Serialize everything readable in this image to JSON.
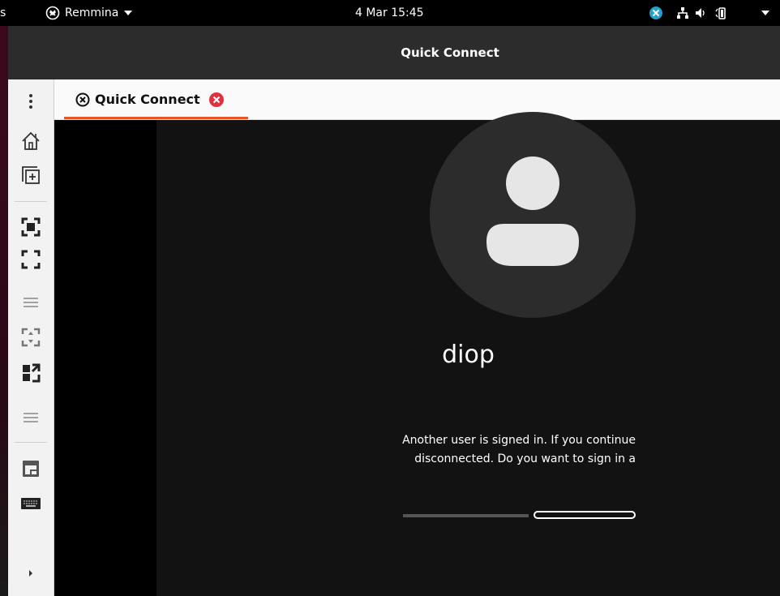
{
  "topbar": {
    "activities_fragment": "s",
    "app_menu_label": "Remmina",
    "clock": "4 Mar  15:45"
  },
  "window": {
    "title": "Quick Connect"
  },
  "toolbar": {
    "items": [
      {
        "icon": "kebab-menu-icon"
      },
      {
        "icon": "home-icon"
      },
      {
        "icon": "new-connection-icon"
      },
      {
        "icon": "toggle-fullscreen-icon"
      },
      {
        "icon": "fullscreen-mode-icon"
      },
      {
        "icon": "menu-icon"
      },
      {
        "icon": "scale-icon"
      },
      {
        "icon": "fit-window-icon"
      },
      {
        "icon": "menu-icon"
      },
      {
        "icon": "switch-tab-icon"
      },
      {
        "icon": "keyboard-icon"
      },
      {
        "icon": "expand-arrow-icon"
      }
    ]
  },
  "tab": {
    "label": "Quick Connect",
    "accent": "#e95420",
    "close_color": "#e0323c"
  },
  "remote": {
    "username": "diop",
    "message_line1": "Another user is signed in. If you continue",
    "message_line2": "disconnected. Do you want to sign in a"
  }
}
